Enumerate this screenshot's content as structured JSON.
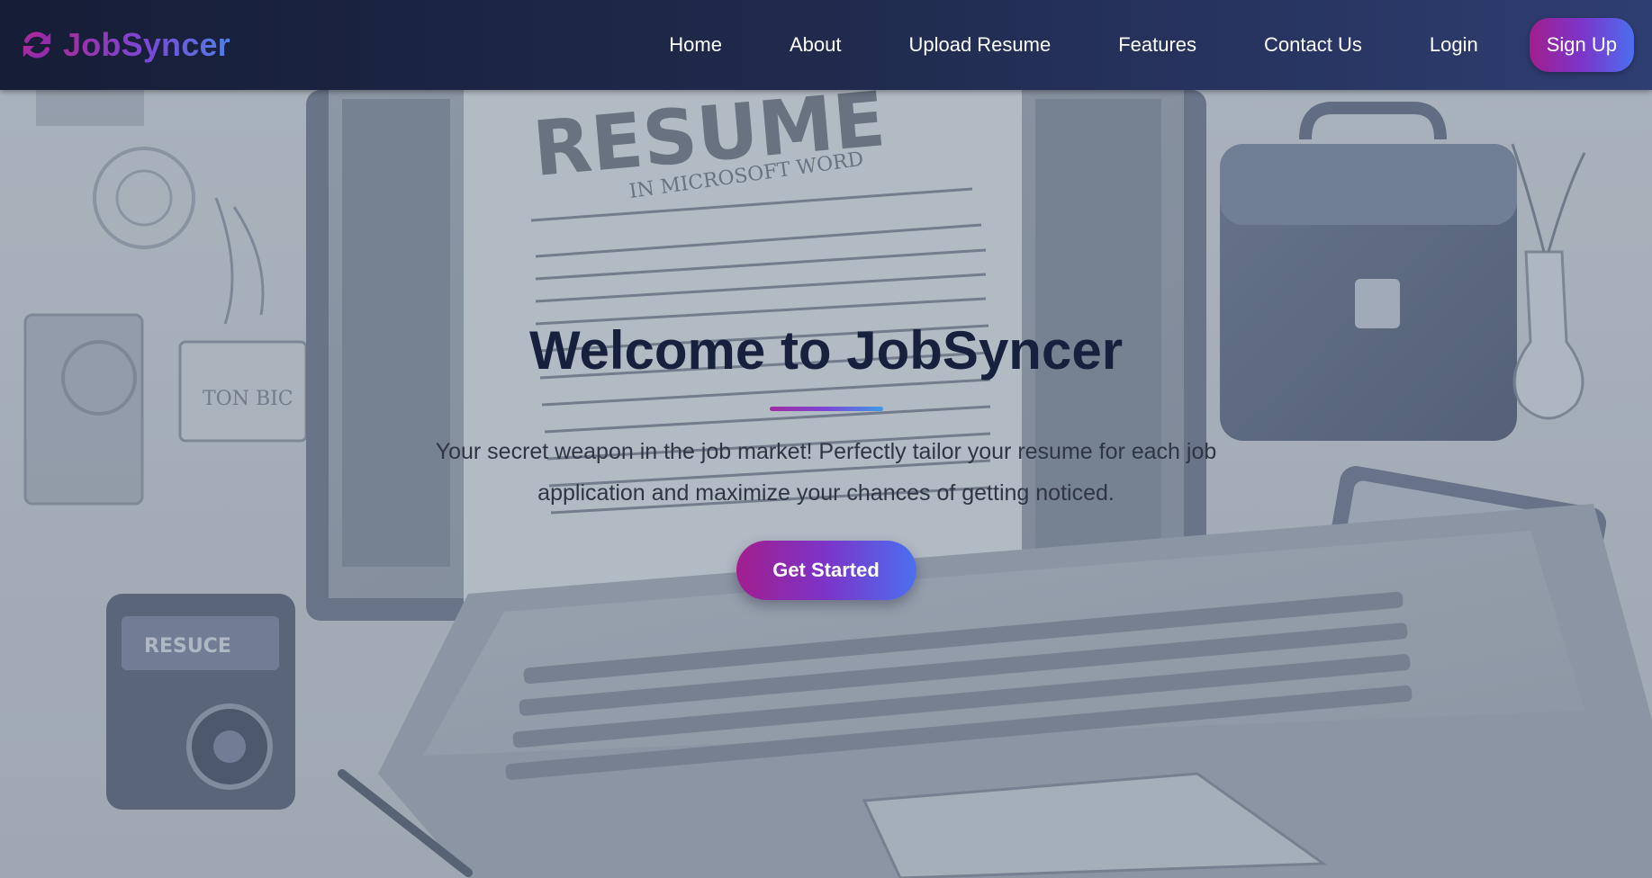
{
  "brand": {
    "name": "JobSyncer",
    "icon": "sync-icon"
  },
  "nav": {
    "links": [
      {
        "label": "Home"
      },
      {
        "label": "About"
      },
      {
        "label": "Upload Resume"
      },
      {
        "label": "Features"
      },
      {
        "label": "Contact Us"
      },
      {
        "label": "Login"
      }
    ],
    "signup_label": "Sign Up"
  },
  "hero": {
    "title": "Welcome to JobSyncer",
    "subtitle": "Your secret weapon in the job market! Perfectly tailor your resume for each job application and maximize your chances of getting noticed.",
    "cta_label": "Get Started",
    "background_art": {
      "resume_heading": "RESUME",
      "resume_subheading": "IN MICROSOFT WORD",
      "badge_text": "TON BIC",
      "device_label": "RESUCE"
    }
  },
  "colors": {
    "nav_bg_start": "#161d36",
    "nav_bg_end": "#2f3e72",
    "accent_magenta": "#a21e8e",
    "accent_purple": "#7b35c9",
    "accent_blue": "#4b6ff0",
    "title_text": "#17203c",
    "subtitle_text": "#2f3545"
  }
}
